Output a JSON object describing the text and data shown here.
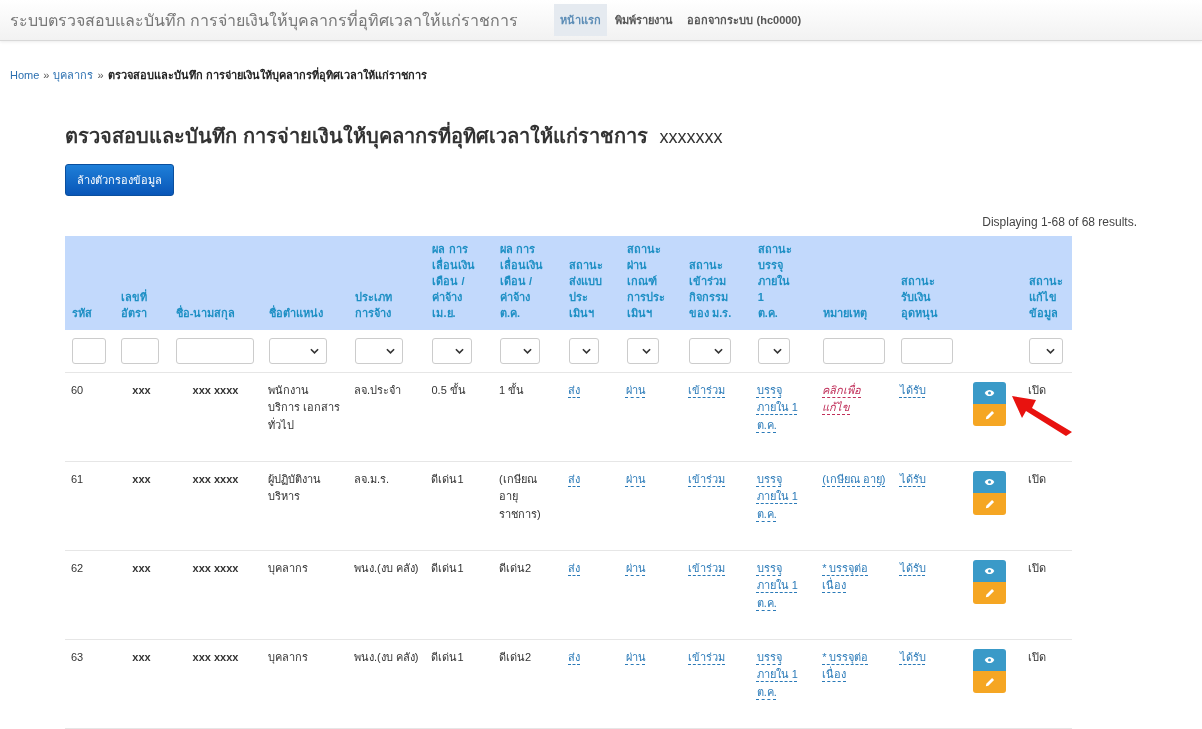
{
  "navbar": {
    "brand": "ระบบตรวจสอบและบันทึก การจ่ายเงินให้บุคลากรที่อุทิศเวลาให้แก่ราชการ",
    "items": [
      {
        "label": "หน้าแรก",
        "selected": true
      },
      {
        "label": "พิมพ์รายงาน",
        "selected": false
      },
      {
        "label": "ออกจากระบบ (hc0000)",
        "selected": false
      }
    ]
  },
  "breadcrumb": {
    "links": [
      "Home",
      "บุคลากร"
    ],
    "separator": "»",
    "current": "ตรวจสอบและบันทึก การจ่ายเงินให้บุคลากรที่อุทิศเวลาให้แก่ราชการ"
  },
  "heading": {
    "title": "ตรวจสอบและบันทึก การจ่ายเงินให้บุคลากรที่อุทิศเวลาให้แก่ราชการ",
    "suffix": "xxxxxxx"
  },
  "clear_button": "ล้างตัวกรองข้อมูล",
  "summary": "Displaying 1-68 of 68 results.",
  "table": {
    "columns": [
      {
        "label": [
          "รหัส"
        ],
        "kind": "input"
      },
      {
        "label": [
          "เลขที่",
          "อัตรา"
        ],
        "kind": "input"
      },
      {
        "label": [
          "ชื่อ-นามสกุล"
        ],
        "kind": "input"
      },
      {
        "label": [
          "ชื่อตำแหน่ง"
        ],
        "kind": "select"
      },
      {
        "label": [
          "ประเภท",
          "การจ้าง"
        ],
        "kind": "select"
      },
      {
        "label": [
          "ผล การ",
          "เลื่อนเงิน",
          "เดือน /",
          "ค่าจ้าง",
          "เม.ย."
        ],
        "kind": "select"
      },
      {
        "label": [
          "ผล การ",
          "เลื่อนเงิน",
          "เดือน /",
          "ค่าจ้าง",
          "ต.ค."
        ],
        "kind": "select"
      },
      {
        "label": [
          "สถานะ",
          "ส่งแบบ",
          "ประ",
          "เมินฯ"
        ],
        "kind": "select"
      },
      {
        "label": [
          "สถานะ",
          "ผ่าน",
          "เกณฑ์",
          "การประ",
          "เมินฯ"
        ],
        "kind": "select"
      },
      {
        "label": [
          "สถานะ",
          "เข้าร่วม",
          "กิจกรรม",
          "ของ ม.ร."
        ],
        "kind": "select"
      },
      {
        "label": [
          "สถานะ",
          "บรรจุ",
          "ภายใน",
          "1",
          "ต.ค."
        ],
        "kind": "select"
      },
      {
        "label": [
          "หมายเหตุ"
        ],
        "kind": "input"
      },
      {
        "label": [
          "สถานะ",
          "รับเงิน",
          "อุดหนุน"
        ],
        "kind": "input"
      },
      {
        "kind": "none"
      },
      {
        "label": [
          "สถานะ",
          "แก้ไข",
          "ข้อมูล"
        ],
        "kind": "select"
      }
    ],
    "rows": [
      {
        "id": "60",
        "number": "xxx",
        "name": "xxx xxxx",
        "position": "พนักงาน บริการ เอกสารทั่วไป",
        "type": "ลจ.ประจำ",
        "result_apr": "0.5 ขั้น",
        "result_oct": "1 ขั้น",
        "sent": "ส่ง",
        "passed": "ผ่าน",
        "joined": "เข้าร่วม",
        "placed": "บรรจุ ภายใน 1 ต.ค.",
        "note": {
          "text": "คลิกเพื่อ แก้ไข",
          "kind": "alert"
        },
        "funding": "ได้รับ",
        "edit_status": "เปิด"
      },
      {
        "id": "61",
        "number": "xxx",
        "name": "xxx xxxx",
        "position": "ผู้ปฏิบัติงาน บริหาร",
        "type": "ลจ.ม.ร.",
        "result_apr": "ดีเด่น1",
        "result_oct": "(เกษียณ อายุ ราชการ)",
        "sent": "ส่ง",
        "passed": "ผ่าน",
        "joined": "เข้าร่วม",
        "placed": "บรรจุ ภายใน 1 ต.ค.",
        "note": {
          "text": "(เกษียณ อายุ)",
          "kind": "link"
        },
        "funding": "ได้รับ",
        "edit_status": "เปิด"
      },
      {
        "id": "62",
        "number": "xxx",
        "name": "xxx xxxx",
        "position": "บุคลากร",
        "type": "พนง.(งบ คลัง)",
        "result_apr": "ดีเด่น1",
        "result_oct": "ดีเด่น2",
        "sent": "ส่ง",
        "passed": "ผ่าน",
        "joined": "เข้าร่วม",
        "placed": "บรรจุ ภายใน 1 ต.ค.",
        "note": {
          "text": "* บรรจุต่อ เนื่อง",
          "kind": "link"
        },
        "funding": "ได้รับ",
        "edit_status": "เปิด"
      },
      {
        "id": "63",
        "number": "xxx",
        "name": "xxx xxxx",
        "position": "บุคลากร",
        "type": "พนง.(งบ คลัง)",
        "result_apr": "ดีเด่น1",
        "result_oct": "ดีเด่น2",
        "sent": "ส่ง",
        "passed": "ผ่าน",
        "joined": "เข้าร่วม",
        "placed": "บรรจุ ภายใน 1 ต.ค.",
        "note": {
          "text": "* บรรจุต่อ เนื่อง",
          "kind": "link"
        },
        "funding": "ได้รับ",
        "edit_status": "เปิด"
      }
    ]
  }
}
